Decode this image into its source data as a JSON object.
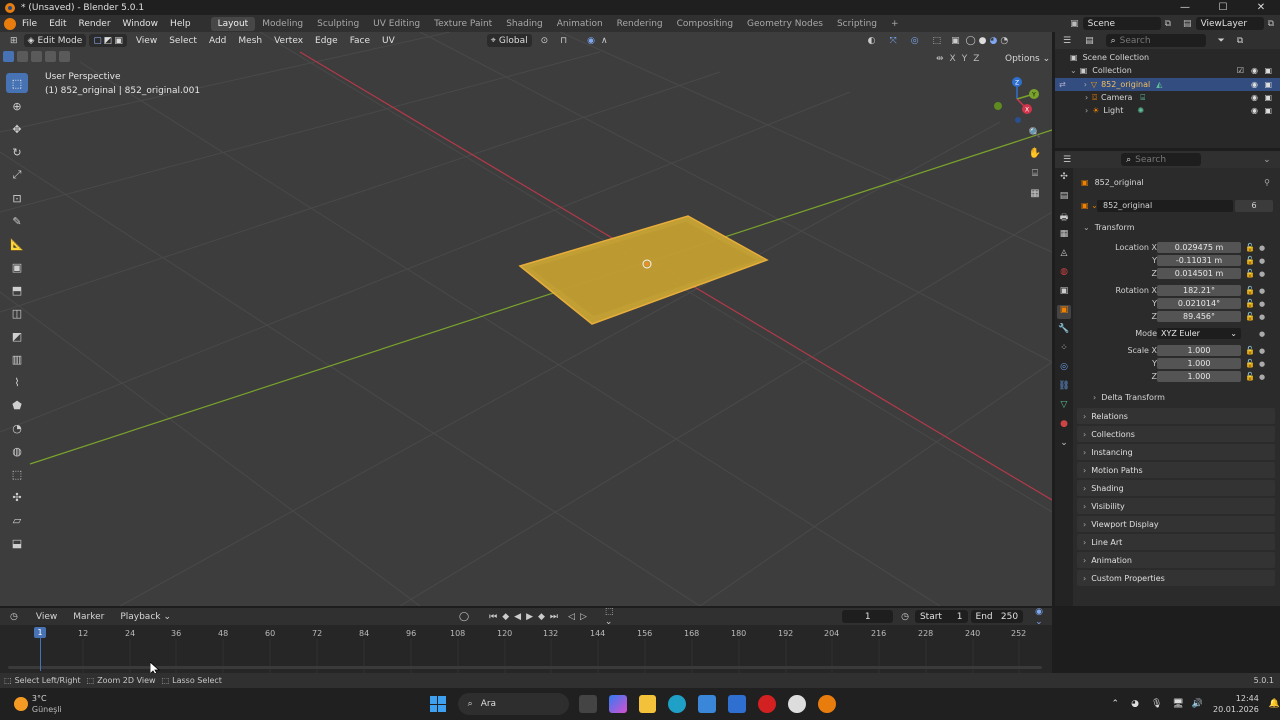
{
  "window": {
    "title": "* (Unsaved) - Blender 5.0.1",
    "controls": [
      "—",
      "☐",
      "✕"
    ]
  },
  "menu": [
    "File",
    "Edit",
    "Render",
    "Window",
    "Help"
  ],
  "workspaces": [
    "Layout",
    "Modeling",
    "Sculpting",
    "UV Editing",
    "Texture Paint",
    "Shading",
    "Animation",
    "Rendering",
    "Compositing",
    "Geometry Nodes",
    "Scripting"
  ],
  "active_workspace": "Layout",
  "scene": {
    "label": "Scene",
    "view_layer": "ViewLayer"
  },
  "viewport": {
    "mode": "Edit Mode",
    "menus": [
      "View",
      "Select",
      "Add",
      "Mesh",
      "Vertex",
      "Edge",
      "Face",
      "UV"
    ],
    "transform_orientation": "Global",
    "options_label": "Options",
    "axes": [
      "X",
      "Y",
      "Z"
    ],
    "info_line1": "User Perspective",
    "info_line2": "(1) 852_original | 852_original.001",
    "gizmo_axes": [
      "X",
      "Y",
      "Z"
    ],
    "colors": {
      "bg": "#3d3d3d",
      "grid": "#494949",
      "x_axis": "#b3394a",
      "y_axis": "#7aa32c",
      "selection": "#f1b43b"
    }
  },
  "toolbar_tools": [
    "select-box",
    "cursor",
    "move",
    "rotate",
    "scale",
    "transform",
    "annotate",
    "measure",
    "add-cube",
    "extrude",
    "inset",
    "bevel",
    "loop-cut",
    "knife",
    "poly-build",
    "spin",
    "smooth",
    "edge-slide",
    "shrink-fatten",
    "shear",
    "rip-region"
  ],
  "outliner": {
    "search_placeholder": "Search",
    "root": "Scene Collection",
    "collection": "Collection",
    "items": [
      {
        "name": "852_original",
        "selected": true
      },
      {
        "name": "Camera",
        "selected": false
      },
      {
        "name": "Light",
        "selected": false
      }
    ]
  },
  "properties": {
    "search_placeholder": "Search",
    "object_name": "852_original",
    "data_name": "852_original",
    "users": "6",
    "transform_label": "Transform",
    "location": {
      "label": "Location X",
      "x": "0.029475 m",
      "y": "-0.11031 m",
      "z": "0.014501 m"
    },
    "rotation": {
      "label": "Rotation X",
      "x": "182.21°",
      "y": "0.021014°",
      "z": "89.456°"
    },
    "mode": {
      "label": "Mode",
      "value": "XYZ Euler"
    },
    "scale": {
      "label": "Scale X",
      "x": "1.000",
      "y": "1.000",
      "z": "1.000"
    },
    "axis_y": "Y",
    "axis_z": "Z",
    "delta_transform": "Delta Transform",
    "panels": [
      "Relations",
      "Collections",
      "Instancing",
      "Motion Paths",
      "Shading",
      "Visibility",
      "Viewport Display",
      "Line Art",
      "Animation",
      "Custom Properties"
    ]
  },
  "timeline": {
    "menus": [
      "View",
      "Marker",
      "Playback"
    ],
    "current_frame": "1",
    "start_label": "Start",
    "start": "1",
    "end_label": "End",
    "end": "250",
    "ticks": [
      "12",
      "24",
      "36",
      "48",
      "60",
      "72",
      "84",
      "96",
      "108",
      "120",
      "132",
      "144",
      "156",
      "168",
      "180",
      "192",
      "204",
      "216",
      "228",
      "240",
      "252"
    ],
    "playhead": "1"
  },
  "statusbar": {
    "items": [
      "Select Left/Right",
      "Zoom 2D View",
      "Lasso Select"
    ],
    "version": "5.0.1"
  },
  "taskbar": {
    "weather_temp": "3°C",
    "weather_desc": "Güneşli",
    "search": "Ara",
    "time": "12:44",
    "date": "20.01.2026"
  }
}
